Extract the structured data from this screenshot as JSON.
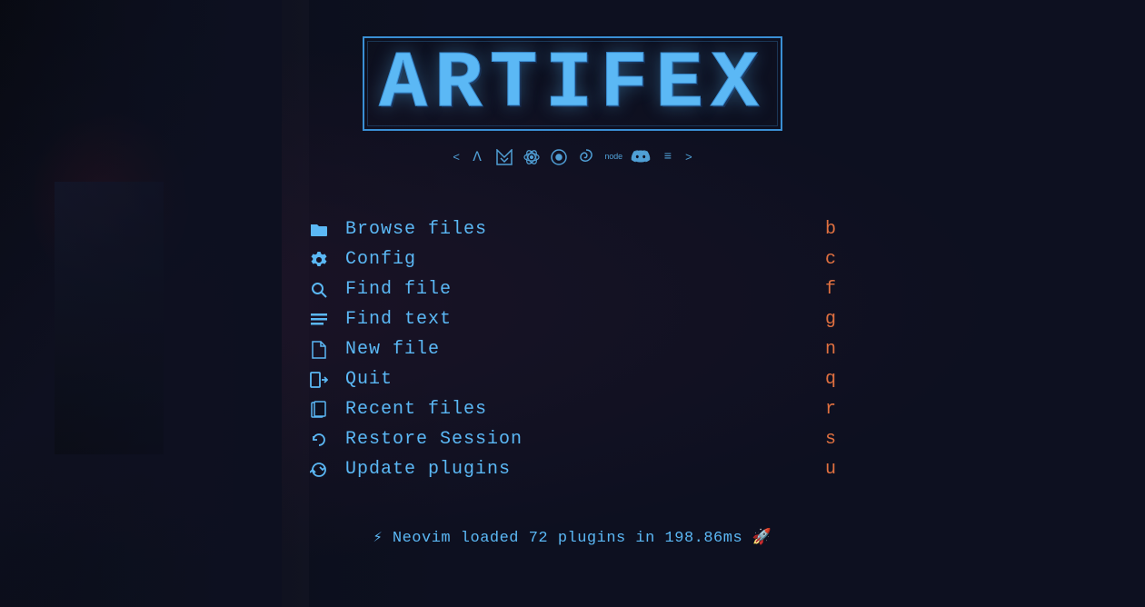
{
  "app": {
    "title": "ARTIFEX"
  },
  "icons_row": {
    "left_chevron": "<",
    "right_chevron": ">",
    "icons": [
      {
        "name": "lambda-icon",
        "symbol": "Λ"
      },
      {
        "name": "vim-icon",
        "symbol": "≪"
      },
      {
        "name": "react-icon",
        "symbol": "⊛"
      },
      {
        "name": "git-icon",
        "symbol": "⊕"
      },
      {
        "name": "swirl-icon",
        "symbol": "⊗"
      },
      {
        "name": "node-icon",
        "symbol": "node"
      },
      {
        "name": "discord-icon",
        "symbol": "☁"
      },
      {
        "name": "extra-icon",
        "symbol": "≡"
      }
    ]
  },
  "menu": {
    "items": [
      {
        "id": "browse-files",
        "label": "Browse files",
        "key": "b",
        "icon": "folder"
      },
      {
        "id": "config",
        "label": "Config",
        "key": "c",
        "icon": "gear"
      },
      {
        "id": "find-file",
        "label": "Find file",
        "key": "f",
        "icon": "search"
      },
      {
        "id": "find-text",
        "label": "Find text",
        "key": "g",
        "icon": "lines"
      },
      {
        "id": "new-file",
        "label": "New file",
        "key": "n",
        "icon": "newfile"
      },
      {
        "id": "quit",
        "label": "Quit",
        "key": "q",
        "icon": "exit"
      },
      {
        "id": "recent-files",
        "label": "Recent files",
        "key": "r",
        "icon": "recent"
      },
      {
        "id": "restore-session",
        "label": "Restore Session",
        "key": "s",
        "icon": "restore"
      },
      {
        "id": "update-plugins",
        "label": " Update plugins",
        "key": "u",
        "icon": "update"
      }
    ]
  },
  "status": {
    "text": "⚡ Neovim loaded 72 plugins in 198.86ms 🚀"
  },
  "colors": {
    "accent": "#5bb8f5",
    "key": "#e07040",
    "bg": "#0d1020"
  }
}
